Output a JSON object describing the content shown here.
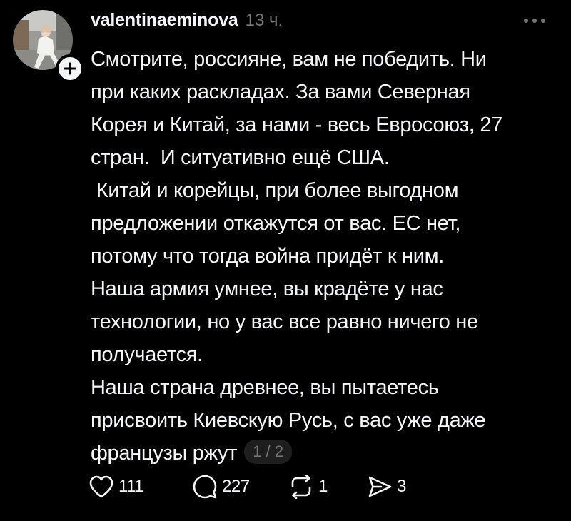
{
  "post": {
    "author": {
      "username": "valentinaeminova",
      "avatar_icon": "profile-photo",
      "follow_icon": "plus-icon"
    },
    "timestamp": "13 ч.",
    "more_icon": "more-horizontal-icon",
    "text_lines": [
      "Смотрите, россияне, вам не победить. Ни",
      "при каких раскладах. За вами Северная",
      "Корея и Китай, за нами - весь Евросоюз, 27",
      "стран.  И ситуативно ещё США.",
      " Китай и корейцы, при более выгодном",
      "предложении откажутся от вас. ЕС нет,",
      "потому что тогда война придёт к ним.",
      "Наша армия умнее, вы крадёте у нас",
      "технологии, но у вас все равно ничего не",
      "получается.",
      "Наша страна древнее, вы пытаетесь",
      "присвоить Киевскую Русь, с вас уже даже",
      "французы ржут"
    ],
    "page_indicator": "1 / 2",
    "actions": {
      "likes": "111",
      "replies": "227",
      "reposts": "1",
      "shares": "3"
    }
  },
  "colors": {
    "background": "#000000",
    "text": "#f3f5f7",
    "secondary": "#777777",
    "pill": "#1e1e1e"
  }
}
